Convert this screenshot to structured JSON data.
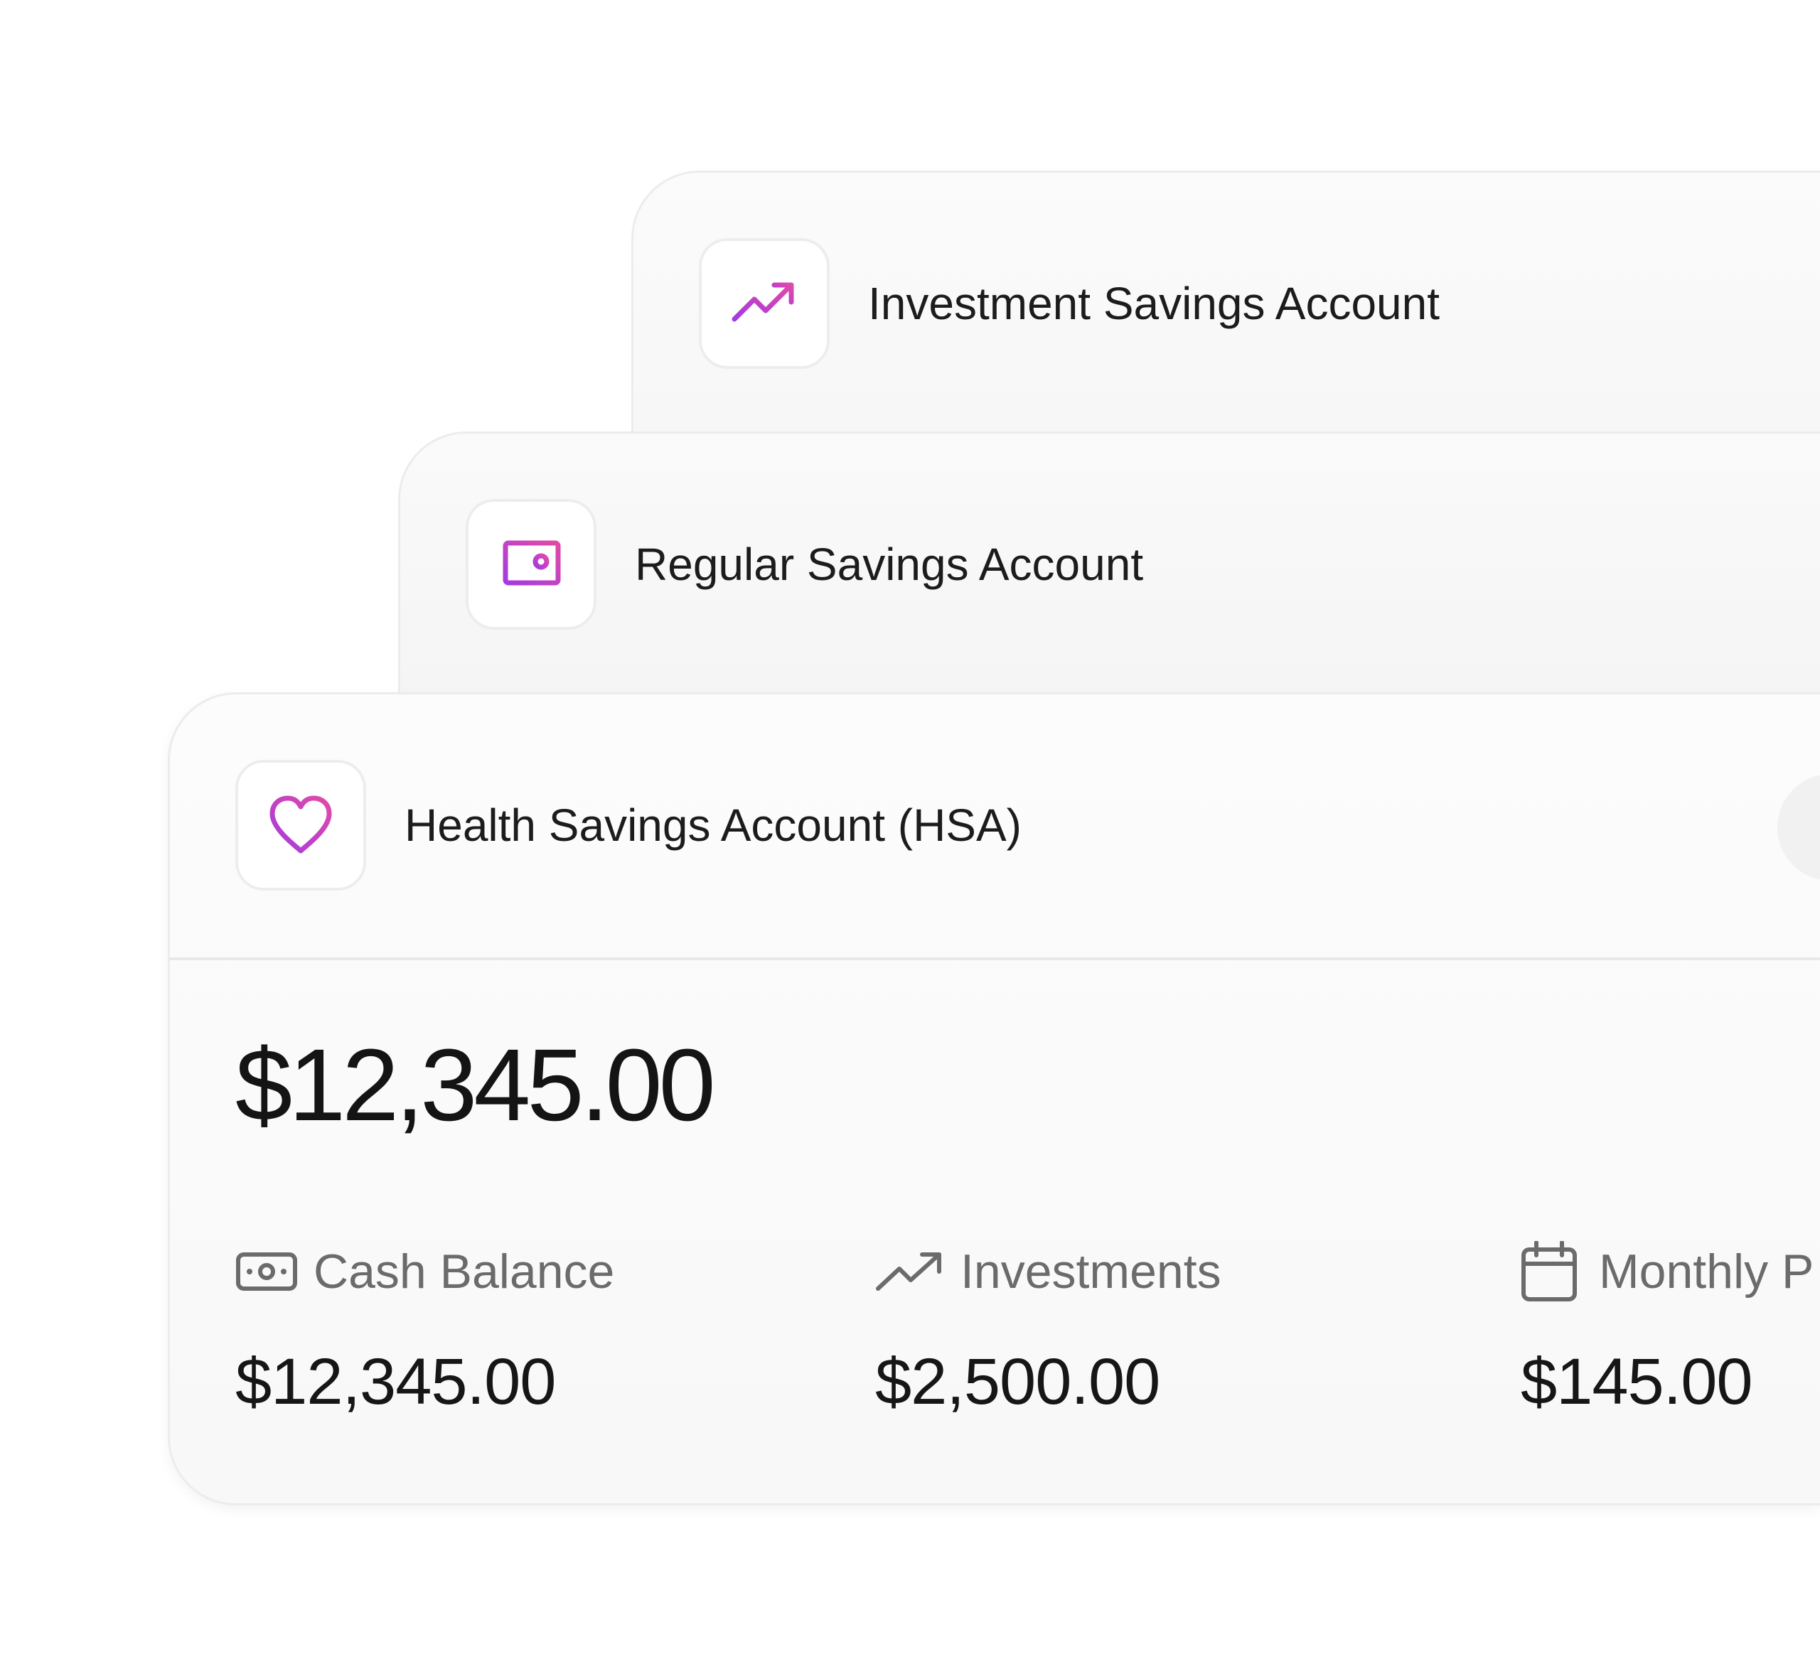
{
  "colors": {
    "accent_start": "#a43be0",
    "accent_end": "#e14aa8",
    "stat_icon": "#6b6b6b"
  },
  "cards": [
    {
      "title": "Investment Savings Account",
      "icon": "trending-up-icon"
    },
    {
      "title": "Regular Savings Account",
      "icon": "safe-icon"
    },
    {
      "title": "Health Savings Account (HSA)",
      "icon": "heart-icon",
      "balance": "$12,345.00",
      "stats": [
        {
          "label": "Cash Balance",
          "value": "$12,345.00",
          "icon": "cash-icon"
        },
        {
          "label": "Investments",
          "value": "$2,500.00",
          "icon": "trending-up-icon"
        },
        {
          "label": "Monthly P",
          "value": "$145.00",
          "icon": "calendar-icon"
        }
      ]
    }
  ]
}
